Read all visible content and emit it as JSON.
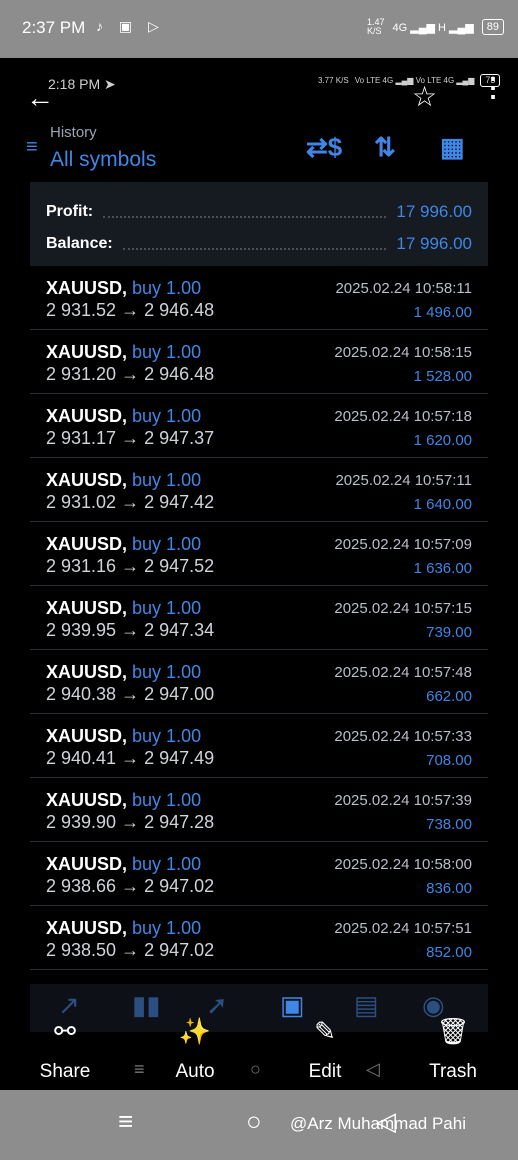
{
  "outer_status": {
    "time": "2:37 PM",
    "left_icons": "♪ ▣ ▷",
    "speed": "1.47\nK/S",
    "signal": "4G ▂▄▆ H ▂▄▆",
    "battery": "89"
  },
  "inner_status": {
    "time": "2:18 PM",
    "nav_icon": "➤",
    "speed": "3.77 K/S",
    "signal": "Vo LTE 4G ▂▄▆ Vo LTE 4G ▂▄▆",
    "battery": "73"
  },
  "header": {
    "section": "History",
    "title": "All symbols"
  },
  "summary": {
    "profit_label": "Profit:",
    "profit_value": "17 996.00",
    "balance_label": "Balance:",
    "balance_value": "17 996.00"
  },
  "deals": [
    {
      "symbol": "XAUUSD,",
      "type": "buy 1.00",
      "prices": "2 931.52 → 2 946.48",
      "datetime": "2025.02.24 10:58:11",
      "profit": "1 496.00"
    },
    {
      "symbol": "XAUUSD,",
      "type": "buy 1.00",
      "prices": "2 931.20 → 2 946.48",
      "datetime": "2025.02.24 10:58:15",
      "profit": "1 528.00"
    },
    {
      "symbol": "XAUUSD,",
      "type": "buy 1.00",
      "prices": "2 931.17 → 2 947.37",
      "datetime": "2025.02.24 10:57:18",
      "profit": "1 620.00"
    },
    {
      "symbol": "XAUUSD,",
      "type": "buy 1.00",
      "prices": "2 931.02 → 2 947.42",
      "datetime": "2025.02.24 10:57:11",
      "profit": "1 640.00"
    },
    {
      "symbol": "XAUUSD,",
      "type": "buy 1.00",
      "prices": "2 931.16 → 2 947.52",
      "datetime": "2025.02.24 10:57:09",
      "profit": "1 636.00"
    },
    {
      "symbol": "XAUUSD,",
      "type": "buy 1.00",
      "prices": "2 939.95 → 2 947.34",
      "datetime": "2025.02.24 10:57:15",
      "profit": "739.00"
    },
    {
      "symbol": "XAUUSD,",
      "type": "buy 1.00",
      "prices": "2 940.38 → 2 947.00",
      "datetime": "2025.02.24 10:57:48",
      "profit": "662.00"
    },
    {
      "symbol": "XAUUSD,",
      "type": "buy 1.00",
      "prices": "2 940.41 → 2 947.49",
      "datetime": "2025.02.24 10:57:33",
      "profit": "708.00"
    },
    {
      "symbol": "XAUUSD,",
      "type": "buy 1.00",
      "prices": "2 939.90 → 2 947.28",
      "datetime": "2025.02.24 10:57:39",
      "profit": "738.00"
    },
    {
      "symbol": "XAUUSD,",
      "type": "buy 1.00",
      "prices": "2 938.66 → 2 947.02",
      "datetime": "2025.02.24 10:58:00",
      "profit": "836.00"
    },
    {
      "symbol": "XAUUSD,",
      "type": "buy 1.00",
      "prices": "2 938.50 → 2 947.02",
      "datetime": "2025.02.24 10:57:51",
      "profit": "852.00"
    }
  ],
  "actions": {
    "share": "Share",
    "auto": "Auto",
    "edit": "Edit",
    "trash": "Trash"
  },
  "watermark": "@Arz Muhammad Pahi",
  "colors": {
    "accent": "#3f86e6",
    "background": "#000000",
    "panel": "#161a21"
  },
  "icons": [
    "back-arrow-icon",
    "star-icon",
    "more-vert-icon",
    "menu-icon",
    "dollar-swap-icon",
    "sort-icon",
    "calendar-icon",
    "share-icon",
    "wand-icon",
    "brush-icon",
    "trash-icon"
  ]
}
